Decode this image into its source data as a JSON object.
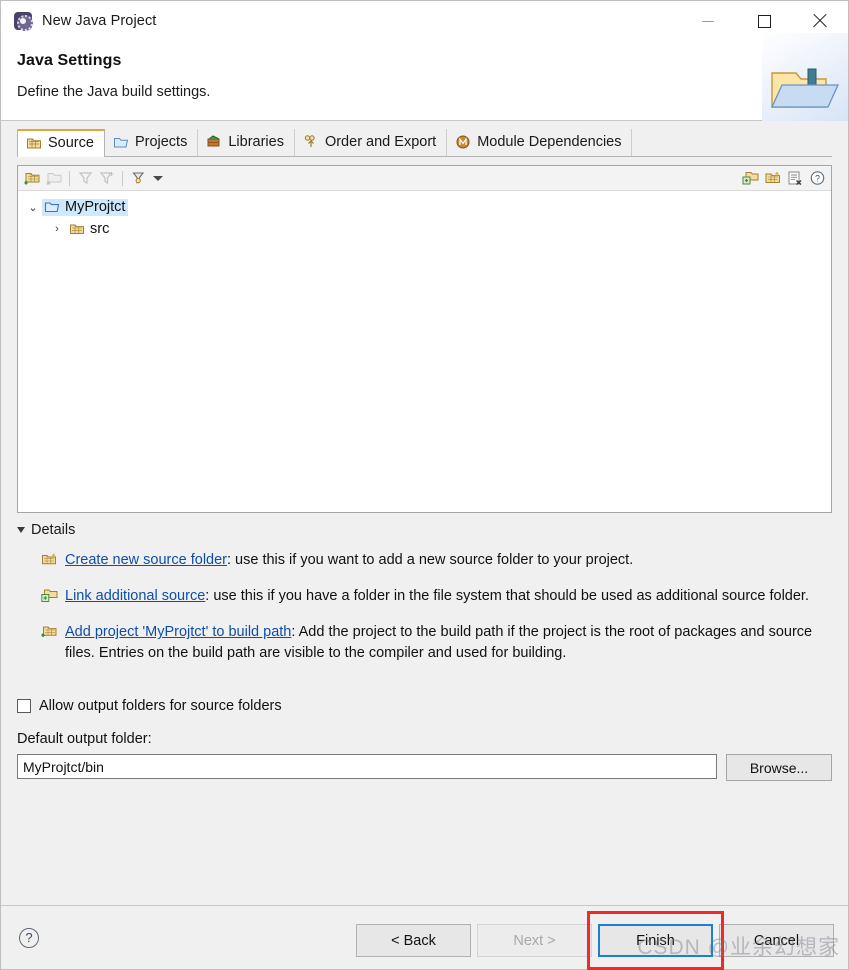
{
  "window": {
    "title": "New Java Project",
    "icon": "eclipse-icon",
    "controls": {
      "minimize": "minimize-icon",
      "maximize": "maximize-icon",
      "close": "close-icon"
    }
  },
  "header": {
    "title": "Java Settings",
    "subtitle": "Define the Java build settings.",
    "art_icon": "folder-art-icon"
  },
  "tabs": [
    {
      "label": "Source",
      "icon": "source-folder-icon",
      "active": true
    },
    {
      "label": "Projects",
      "icon": "projects-icon",
      "active": false
    },
    {
      "label": "Libraries",
      "icon": "libraries-icon",
      "active": false
    },
    {
      "label": "Order and Export",
      "icon": "order-export-icon",
      "active": false
    },
    {
      "label": "Module Dependencies",
      "icon": "module-dependencies-icon",
      "active": false
    }
  ],
  "tree_toolbar": {
    "left": [
      {
        "name": "add-folder-icon",
        "enabled": true
      },
      {
        "name": "remove-folder-icon",
        "enabled": false
      },
      {
        "name": "add-filter-icon",
        "enabled": false
      },
      {
        "name": "edit-filter-icon",
        "enabled": false
      },
      {
        "name": "configure-filters-icon",
        "enabled": true
      }
    ],
    "menu_icon": "dropdown-caret-icon",
    "right": [
      {
        "name": "link-source-icon"
      },
      {
        "name": "create-folder-icon"
      },
      {
        "name": "remove-entry-icon"
      },
      {
        "name": "help-icon"
      }
    ]
  },
  "tree": {
    "nodes": [
      {
        "label": "MyProjtct",
        "icon": "project-folder-icon",
        "selected": true,
        "expanded": true,
        "twisty": "⌄",
        "level": 0
      },
      {
        "label": "src",
        "icon": "source-folder-icon",
        "selected": false,
        "expanded": false,
        "twisty": "›",
        "level": 1
      }
    ]
  },
  "details": {
    "section_label": "Details",
    "items": [
      {
        "icon": "create-source-folder-icon",
        "link": "Create new source folder",
        "text": ": use this if you want to add a new source folder to your project."
      },
      {
        "icon": "link-source-icon",
        "link": "Link additional source",
        "text": ": use this if you have a folder in the file system that should be used as additional source folder."
      },
      {
        "icon": "add-project-icon",
        "link": "Add project 'MyProjtct' to build path",
        "text": ": Add the project to the build path if the project is the root of packages and source files. Entries on the build path are visible to the compiler and used for building."
      }
    ]
  },
  "form": {
    "allow_output_label": "Allow output folders for source folders",
    "allow_output_checked": false,
    "default_output_label": "Default output folder:",
    "default_output_value": "MyProjtct/bin",
    "browse_label": "Browse..."
  },
  "footer": {
    "help_icon": "help-icon",
    "buttons": [
      {
        "label": "< Back",
        "state": "enabled"
      },
      {
        "label": "Next >",
        "state": "disabled"
      },
      {
        "label": "Finish",
        "state": "default"
      },
      {
        "label": "Cancel",
        "state": "enabled"
      }
    ],
    "watermark": "CSDN @业余幻想家",
    "highlight_color": "#ee2b26",
    "focus_color": "#1d7fd0"
  }
}
